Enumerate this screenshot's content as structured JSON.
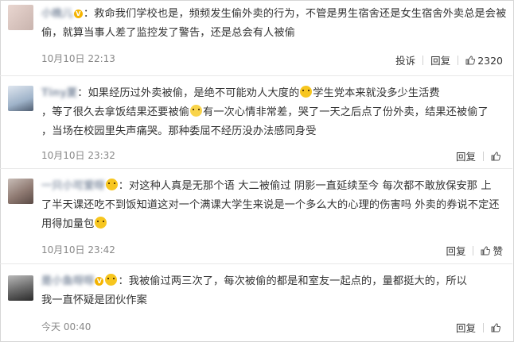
{
  "comments": [
    {
      "username": "小晚儿",
      "line1": "：救命我们学校也是，频频发生偷外卖的行为，不管是男生宿舍还是女生宿舍外卖总是会被",
      "line2": "偷，就算当事人差了监控发了警告，还是总会有人被偷",
      "time": "10月10日 22:13",
      "report": "投诉",
      "reply": "回复",
      "likes": "2320"
    },
    {
      "username": "Tiny夏",
      "line1a": "：如果经历过外卖被偷，是绝不可能劝人大度的",
      "line1b": "学生党本来就没多少生活费",
      "line2a": "，等了很久去拿饭结果还要被偷",
      "line2b": "有一次心情非常差，哭了一天之后点了份外卖，结果还被偷了",
      "line3a": "，当场在校园里失声痛哭。",
      "line3b": "那种委屈不经历没办法感同身受",
      "time": "10月10日 23:32",
      "reply": "回复"
    },
    {
      "username": "一只小可爱呀",
      "line1": "：对这种人真是无那个语 大二被偷过 阴影一直延续至今 每次都不敢放保安那 上",
      "line2": "了半天课还吃不到饭知道这对一个满课大学生来说是一个多么大的心理的伤害吗 外卖的券说不定还",
      "line3": "用得加量包",
      "time": "10月10日 23:42",
      "reply": "回复",
      "like": "赞"
    },
    {
      "username": "是小鱼呀呀",
      "line1": "：我被偷过两三次了，每次被偷的都是和室友一起点的，量都挺大的，所以",
      "line2": "我一直怀疑是团伙作案",
      "time": "今天 00:40",
      "reply": "回复"
    }
  ]
}
